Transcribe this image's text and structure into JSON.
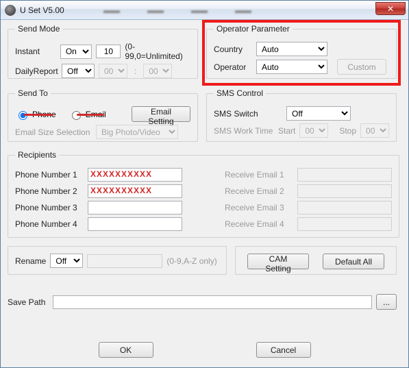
{
  "window": {
    "title": "U Set V5.00",
    "close_glyph": "✕"
  },
  "bg_words": [
    "—",
    "—",
    "—",
    "—"
  ],
  "send_mode": {
    "legend": "Send Mode",
    "instant_label": "Instant",
    "instant_mode": "On",
    "instant_count": "10",
    "instant_hint": "(0-99,0=Unlimited)",
    "daily_label": "DailyReport",
    "daily_mode": "Off",
    "daily_hh": "00",
    "daily_mm": "00"
  },
  "operator": {
    "legend": "Operator Parameter",
    "country_label": "Country",
    "country_value": "Auto",
    "operator_label": "Operator",
    "operator_value": "Auto",
    "custom_label": "Custom"
  },
  "send_to": {
    "legend": "Send To",
    "phone_label": "Phone",
    "email_label": "Email",
    "email_setting_label": "Email Setting",
    "size_label": "Email Size Selection",
    "size_value": "Big Photo/Video"
  },
  "sms": {
    "legend": "SMS Control",
    "switch_label": "SMS Switch",
    "switch_value": "Off",
    "work_label": "SMS Work Time",
    "start_label": "Start",
    "start_value": "00",
    "stop_label": "Stop",
    "stop_value": "00"
  },
  "recipients": {
    "legend": "Recipients",
    "phone_labels": [
      "Phone Number 1",
      "Phone Number 2",
      "Phone Number 3",
      "Phone Number 4"
    ],
    "phone_values": [
      "XXXXXXXXXX",
      "XXXXXXXXXX",
      "",
      ""
    ],
    "email_labels": [
      "Receive Email 1",
      "Receive Email 2",
      "Receive Email 3",
      "Receive Email 4"
    ]
  },
  "rename": {
    "label": "Rename",
    "mode": "Off",
    "value": "",
    "hint": "(0-9,A-Z only)"
  },
  "cam_setting_label": "CAM Setting",
  "default_all_label": "Default All",
  "save_path": {
    "label": "Save Path",
    "value": "",
    "browse": "..."
  },
  "ok_label": "OK",
  "cancel_label": "Cancel"
}
